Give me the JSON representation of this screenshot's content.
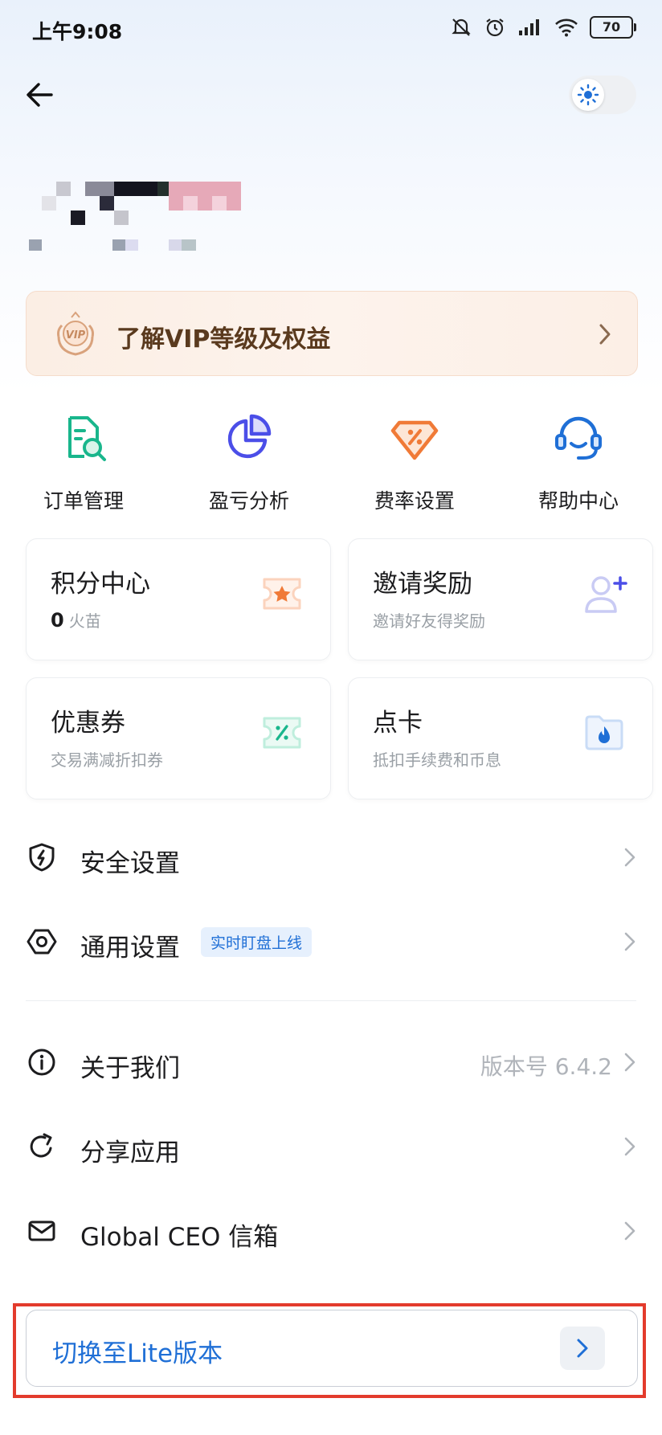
{
  "status_bar": {
    "time": "上午9:08",
    "battery": "70"
  },
  "vip": {
    "label": "了解VIP等级及权益"
  },
  "quick_actions": [
    {
      "label": "订单管理",
      "icon": "order-search-icon",
      "color": "#19b68c"
    },
    {
      "label": "盈亏分析",
      "icon": "pie-chart-icon",
      "color": "#4b4ee8"
    },
    {
      "label": "费率设置",
      "icon": "discount-tag-icon",
      "color": "#f07a37"
    },
    {
      "label": "帮助中心",
      "icon": "headset-icon",
      "color": "#1f6fd6"
    }
  ],
  "cards": [
    {
      "title": "积分中心",
      "value": "0",
      "unit": "火苗",
      "icon": "star-ticket-icon"
    },
    {
      "title": "邀请奖励",
      "sub": "邀请好友得奖励",
      "icon": "add-user-icon"
    },
    {
      "title": "优惠券",
      "sub": "交易满减折扣券",
      "icon": "coupon-icon"
    },
    {
      "title": "点卡",
      "sub": "抵扣手续费和币息",
      "icon": "point-card-icon"
    }
  ],
  "settings": {
    "security": "安全设置",
    "general": "通用设置",
    "general_tag": "实时盯盘上线",
    "about": "关于我们",
    "version": "版本号 6.4.2",
    "share": "分享应用",
    "ceo_mail": "Global CEO 信箱"
  },
  "lite": {
    "label": "切换至Lite版本"
  },
  "colors": {
    "accent": "#1f6fd6",
    "highlight": "#e33b2c"
  }
}
